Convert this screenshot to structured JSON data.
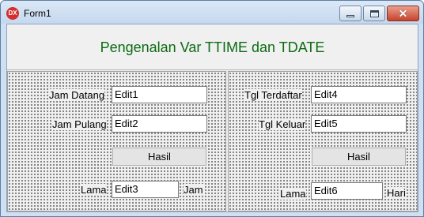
{
  "window": {
    "title": "Form1",
    "icon_text": "DX",
    "close_symbol": "✕"
  },
  "header": {
    "title": "Pengenalan Var TTIME dan TDATE"
  },
  "left_panel": {
    "jam_datang_label": "Jam Datang",
    "jam_datang_value": "Edit1",
    "jam_pulang_label": "Jam Pulang",
    "jam_pulang_value": "Edit2",
    "button_label": "Hasil",
    "lama_label": "Lama",
    "lama_value": "Edit3",
    "unit_label": "Jam"
  },
  "right_panel": {
    "tgl_terdaftar_label": "Tgl Terdaftar",
    "tgl_terdaftar_value": "Edit4",
    "tgl_keluar_label": "Tgl Keluar",
    "tgl_keluar_value": "Edit5",
    "button_label": "Hasil",
    "lama_label": "Lama",
    "lama_value": "Edit6",
    "unit_label": "Hari"
  },
  "colors": {
    "title_green": "#0c6b12",
    "titlebar_blue": "#cfe0f3",
    "close_red": "#c8432b"
  }
}
